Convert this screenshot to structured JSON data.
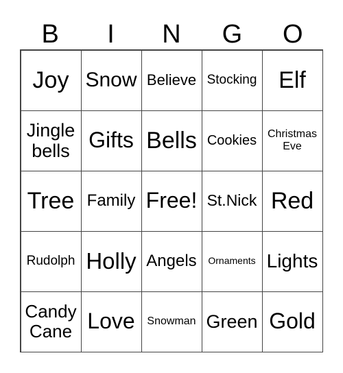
{
  "header": [
    "B",
    "I",
    "N",
    "G",
    "O"
  ],
  "cells": [
    "Joy",
    "Snow",
    "Believe",
    "Stocking",
    "Elf",
    "Jingle\nbells",
    "Gifts",
    "Bells",
    "Cookies",
    "Christmas\nEve",
    "Tree",
    "Family",
    "Free!",
    "St.Nick",
    "Red",
    "Rudolph",
    "Holly",
    "Angels",
    "Ornaments",
    "Lights",
    "Candy\nCane",
    "Love",
    "Snowman",
    "Green",
    "Gold"
  ]
}
